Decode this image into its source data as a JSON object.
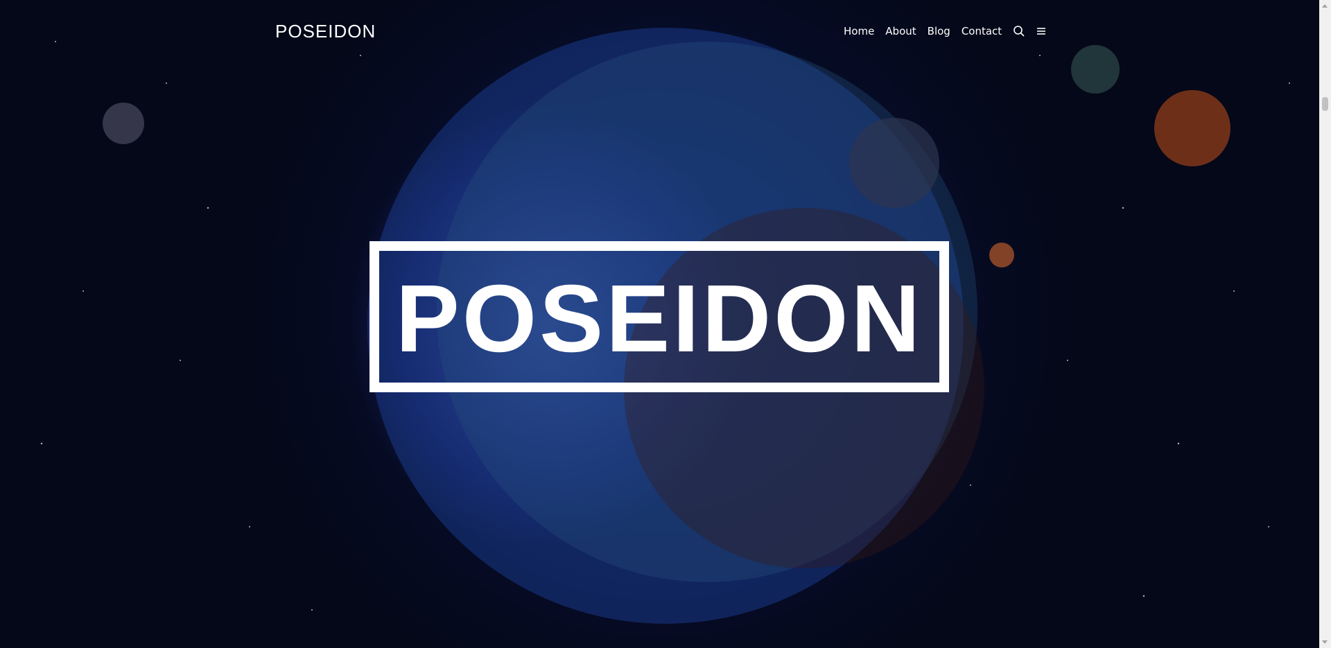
{
  "header": {
    "brand": "POSEIDON",
    "nav": [
      {
        "label": "Home"
      },
      {
        "label": "About"
      },
      {
        "label": "Blog"
      },
      {
        "label": "Contact"
      }
    ],
    "icons": [
      "search-icon",
      "menu-icon"
    ]
  },
  "hero": {
    "title": "POSEIDON"
  },
  "colors": {
    "text": "#ffffff",
    "background": "#050a1c",
    "accent": "#ffffff"
  }
}
